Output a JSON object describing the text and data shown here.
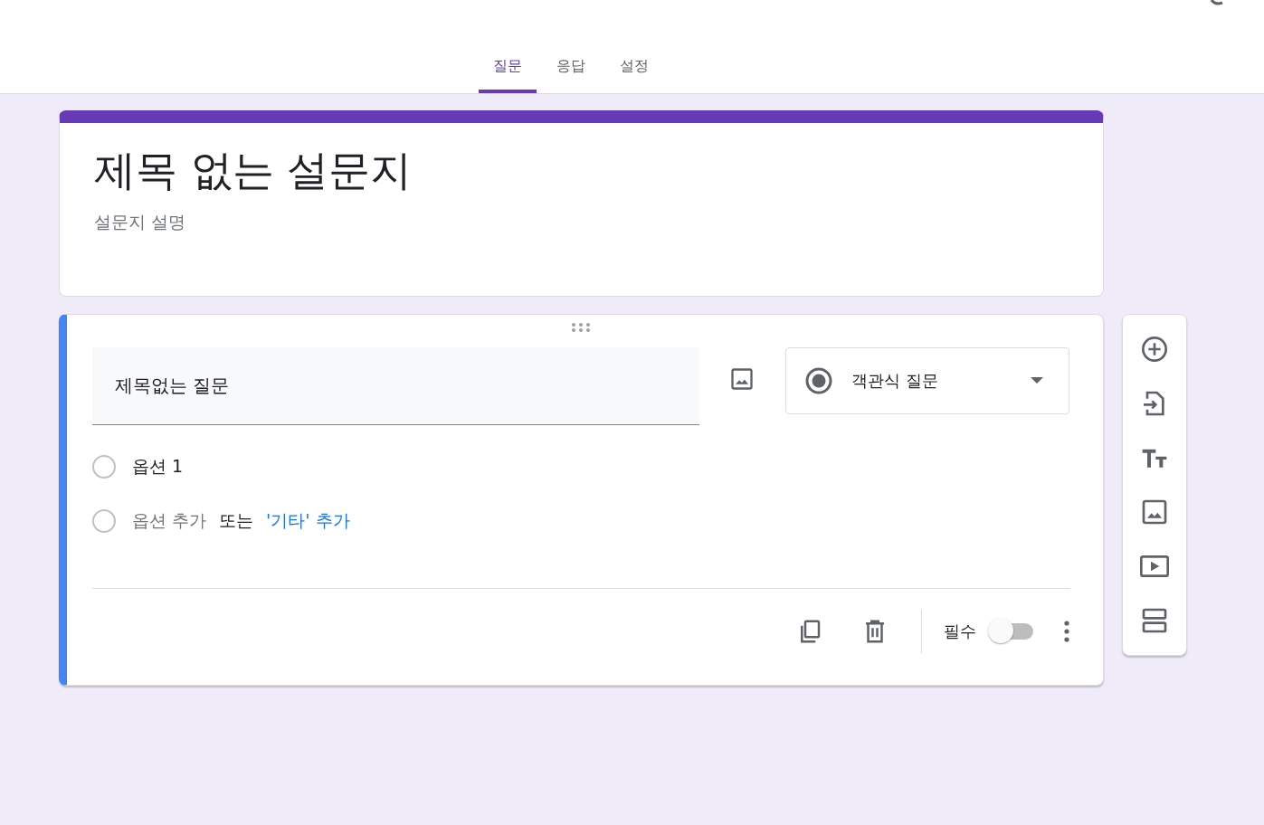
{
  "tabs": [
    {
      "label": "질문",
      "selected": true
    },
    {
      "label": "응답",
      "selected": false
    },
    {
      "label": "설정",
      "selected": false
    }
  ],
  "form": {
    "title": "제목 없는 설문지",
    "description_placeholder": "설문지 설명"
  },
  "question": {
    "title": "제목없는 질문",
    "type": "객관식 질문",
    "options": [
      {
        "label": "옵션 1",
        "selected": false
      }
    ],
    "add_option": {
      "selected": false,
      "text": "옵션 추가",
      "connector": "또는",
      "other_link": "'기타' 추가"
    },
    "required_label": "필수",
    "required": false
  }
}
